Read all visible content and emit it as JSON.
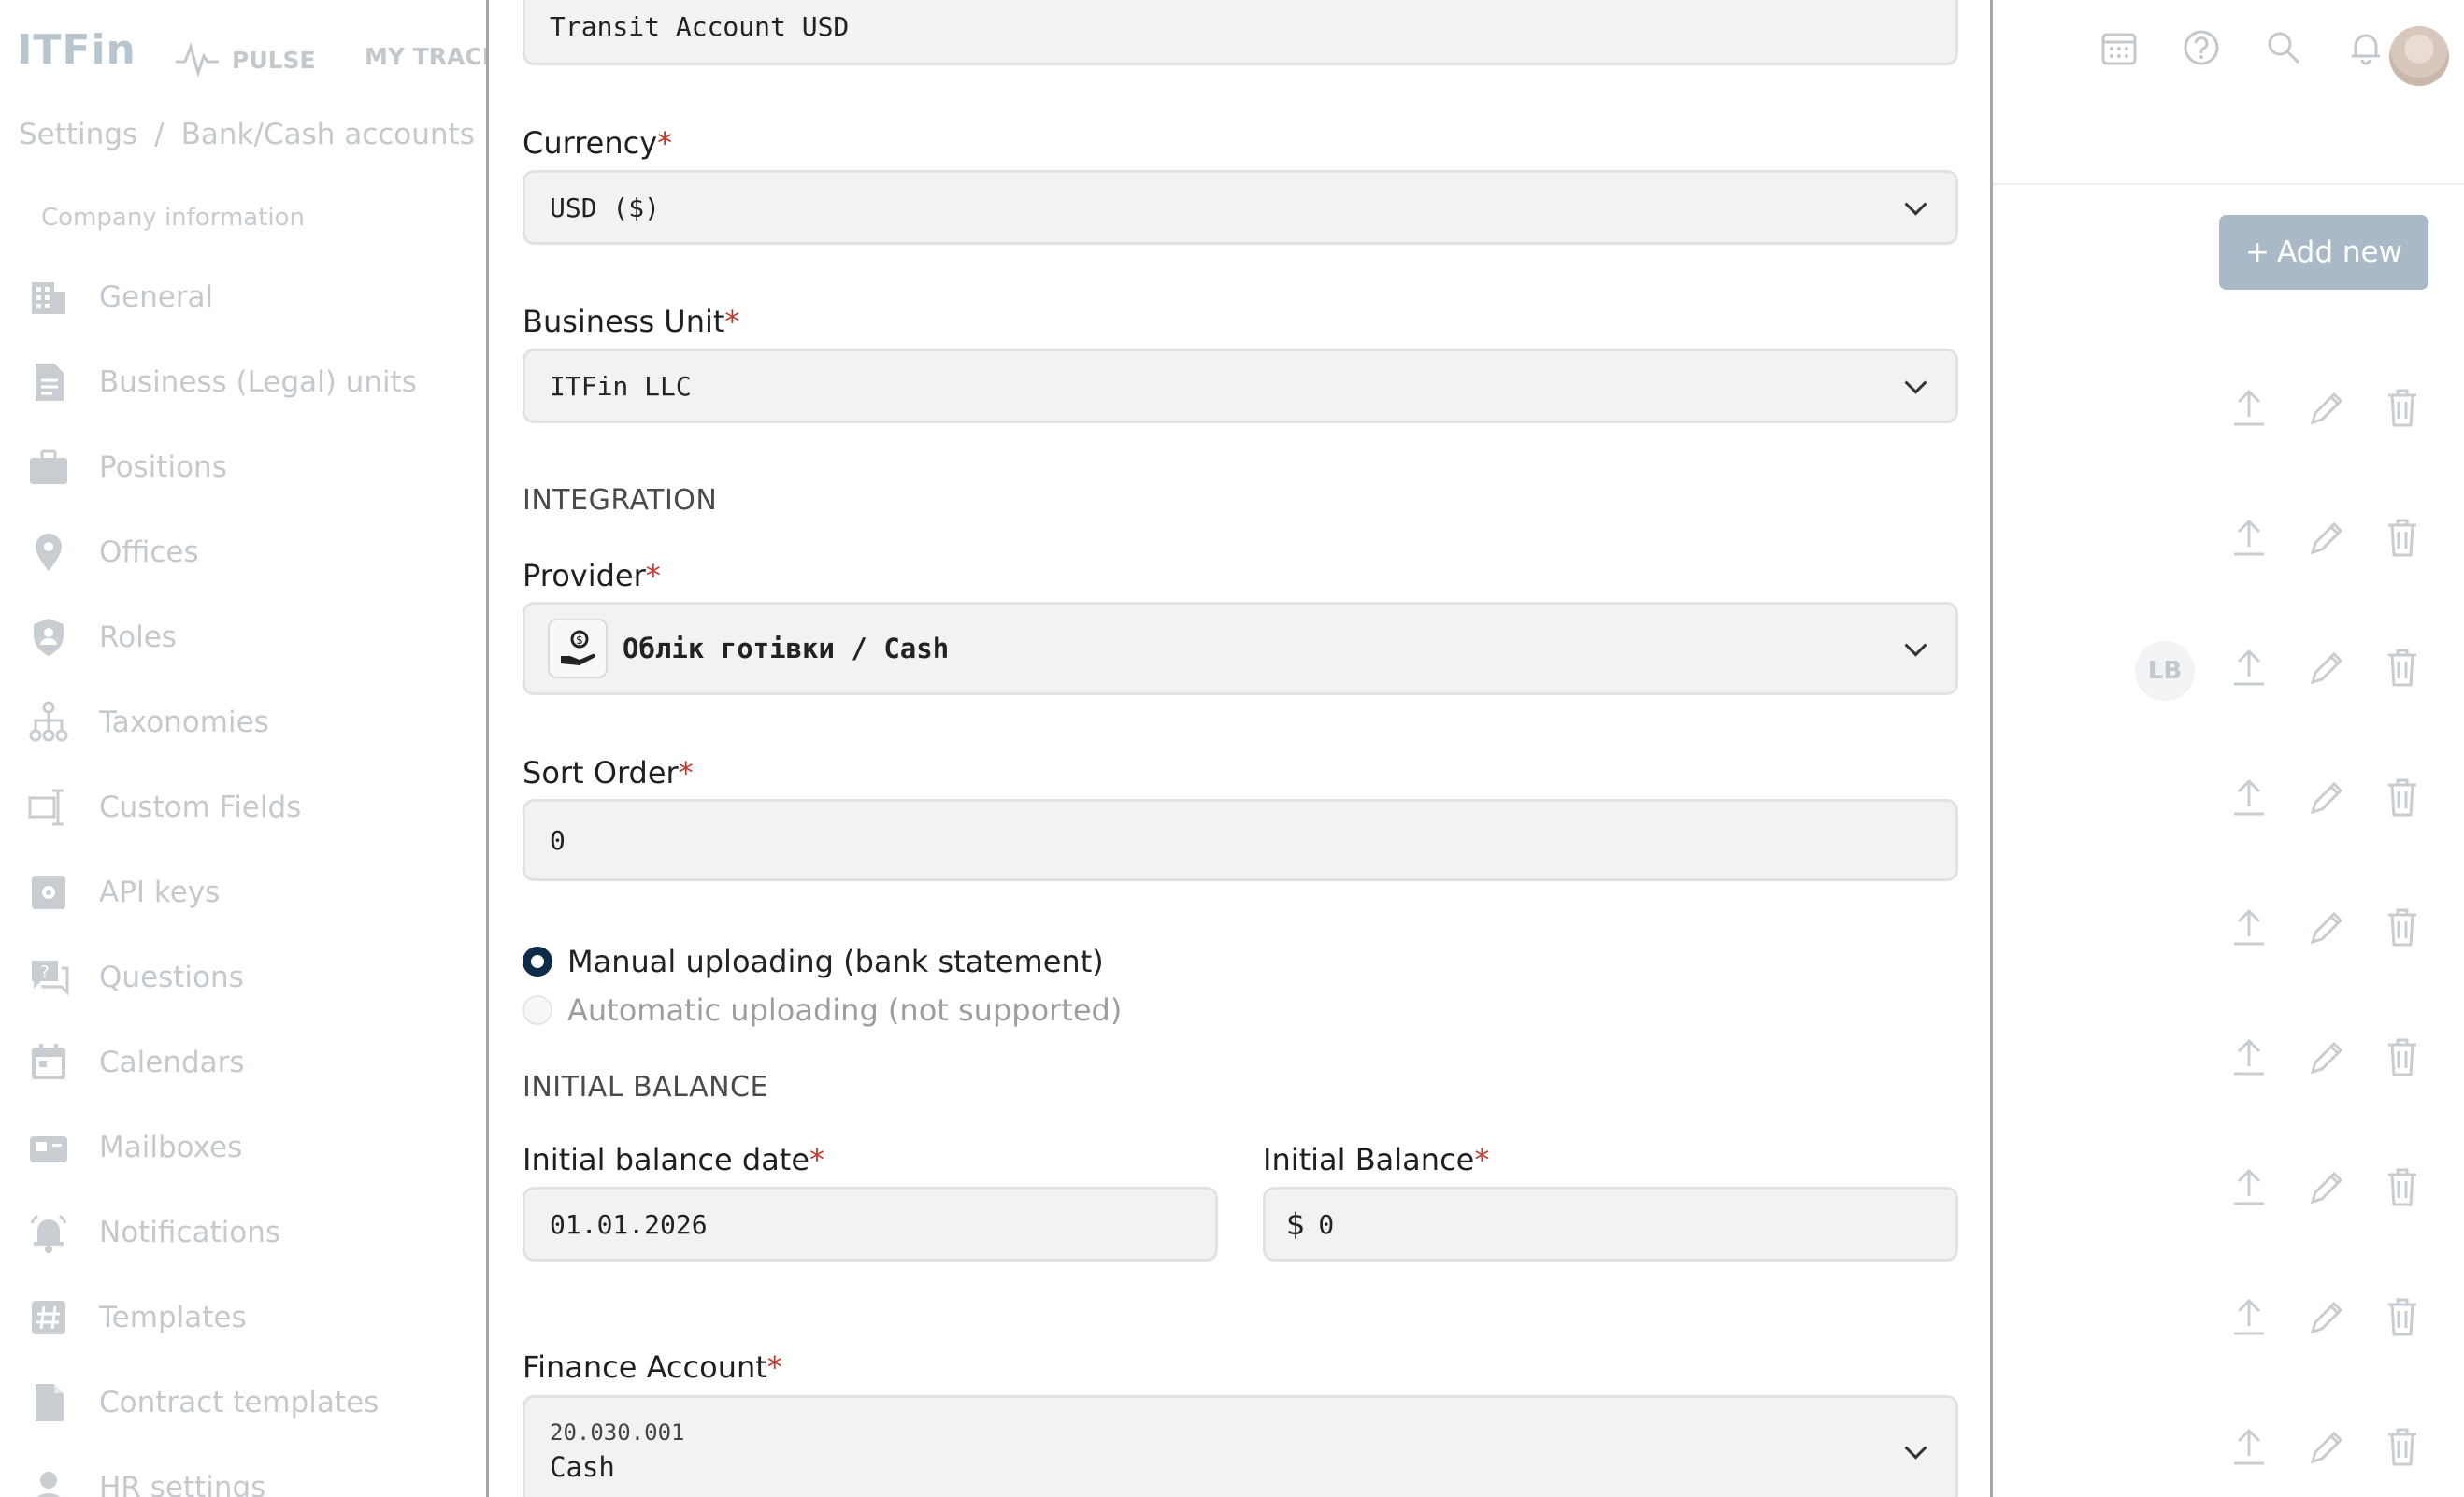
{
  "app": {
    "logo": "ITFin",
    "nav": [
      {
        "label": "PULSE"
      },
      {
        "label": "MY TRACKE"
      }
    ],
    "breadcrumb": {
      "root": "Settings",
      "separator": "/",
      "current": "Bank/Cash accounts"
    }
  },
  "sidebar": {
    "heading": "Company information",
    "items": [
      {
        "label": "General",
        "icon": "building-icon"
      },
      {
        "label": "Business (Legal) units",
        "icon": "document-icon"
      },
      {
        "label": "Positions",
        "icon": "briefcase-icon"
      },
      {
        "label": "Offices",
        "icon": "location-pin-icon"
      },
      {
        "label": "Roles",
        "icon": "shield-user-icon"
      },
      {
        "label": "Taxonomies",
        "icon": "hierarchy-icon"
      },
      {
        "label": "Custom Fields",
        "icon": "text-field-icon"
      },
      {
        "label": "API keys",
        "icon": "api-gear-icon"
      },
      {
        "label": "Questions",
        "icon": "question-chat-icon"
      },
      {
        "label": "Calendars",
        "icon": "calendar-icon"
      },
      {
        "label": "Mailboxes",
        "icon": "mailbox-icon"
      },
      {
        "label": "Notifications",
        "icon": "bell-ring-icon"
      },
      {
        "label": "Templates",
        "icon": "hash-icon"
      },
      {
        "label": "Contract templates",
        "icon": "file-icon"
      },
      {
        "label": "HR settings",
        "icon": "person-icon"
      }
    ]
  },
  "content": {
    "add_new_label": "Add new",
    "avatar_badge": "LB"
  },
  "form": {
    "account_name_value": "Transit Account USD",
    "currency": {
      "label": "Currency",
      "required": "*",
      "value": "USD ($)"
    },
    "business_unit": {
      "label": "Business Unit",
      "required": "*",
      "value": "ITFin LLC"
    },
    "integration_title": "INTEGRATION",
    "provider": {
      "label": "Provider",
      "required": "*",
      "value": "Облік готівки / Cash",
      "icon": "cash-hand-icon"
    },
    "sort_order": {
      "label": "Sort Order",
      "required": "*",
      "value": "0"
    },
    "upload_options": [
      {
        "label": "Manual uploading (bank statement)",
        "selected": true
      },
      {
        "label": "Automatic uploading (not supported)",
        "selected": false
      }
    ],
    "initial_balance_title": "INITIAL BALANCE",
    "initial_balance_date": {
      "label": "Initial balance date",
      "required": "*",
      "value": "01.01.2026"
    },
    "initial_balance": {
      "label": "Initial Balance",
      "required": "*",
      "currency_symbol": "$",
      "value": "0"
    },
    "finance_account": {
      "label": "Finance Account",
      "required": "*",
      "code": "20.030.001",
      "name": "Cash"
    }
  },
  "colors": {
    "primary_dark": "#0d2c4a",
    "required": "#c0392b",
    "field_bg": "#f2f2f2",
    "muted": "#c4c9cd"
  }
}
